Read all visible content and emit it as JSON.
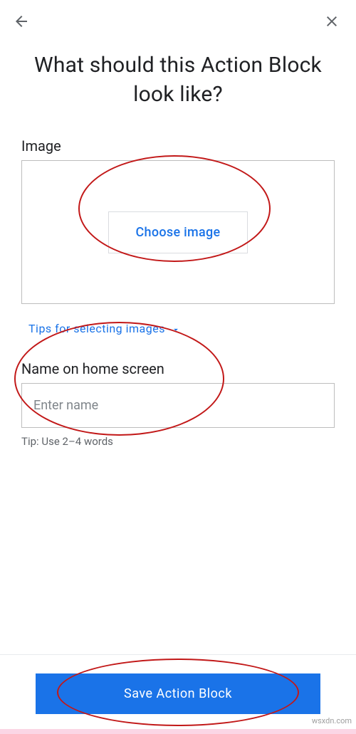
{
  "header": {
    "title": "What should this Action Block look like?"
  },
  "image_section": {
    "label": "Image",
    "choose_button": "Choose image",
    "tips_link": "Tips for selecting images"
  },
  "name_section": {
    "label": "Name on home screen",
    "placeholder": "Enter name",
    "tip": "Tip: Use 2–4 words"
  },
  "footer": {
    "save_button": "Save Action Block"
  },
  "watermark": "wsxdn.com"
}
